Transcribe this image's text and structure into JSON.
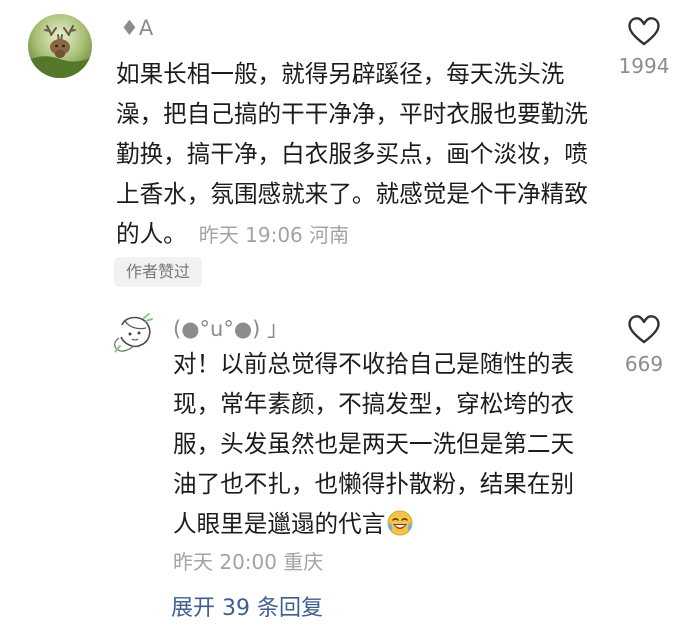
{
  "main_comment": {
    "username": "♦A",
    "text": "如果长相一般，就得另辟蹊径，每天洗头洗澡，把自己搞的干干净净，平时衣服也要勤洗勤换，搞干净，白衣服多买点，画个淡妆，喷上香水，氛围感就来了。就感觉是个干净精致的人。",
    "time": "昨天 19:06",
    "location": "河南",
    "likes": "1994",
    "badge": "作者赞过",
    "avatar_icon": "deer-antler-avatar-icon",
    "like_icon": "heart-outline-icon"
  },
  "reply_comment": {
    "username": "(●°u°●) 」",
    "text": "对！以前总觉得不收拾自己是随性的表现，常年素颜，不搞发型，穿松垮的衣服，头发虽然也是两天一洗但是第二天油了也不扎，也懒得扑散粉，结果在别人眼里是邋遢的代言",
    "emoji": "laughing-crying-emoji-icon",
    "time": "昨天 20:00",
    "location": "重庆",
    "likes": "669",
    "avatar_icon": "sketch-avatar-icon",
    "like_icon": "heart-outline-icon"
  },
  "expand_replies": {
    "label": "展开 39 条回复"
  },
  "colors": {
    "link": "#3f5f8f",
    "meta": "#a3a3a3",
    "badge_bg": "#f1f1f1"
  }
}
